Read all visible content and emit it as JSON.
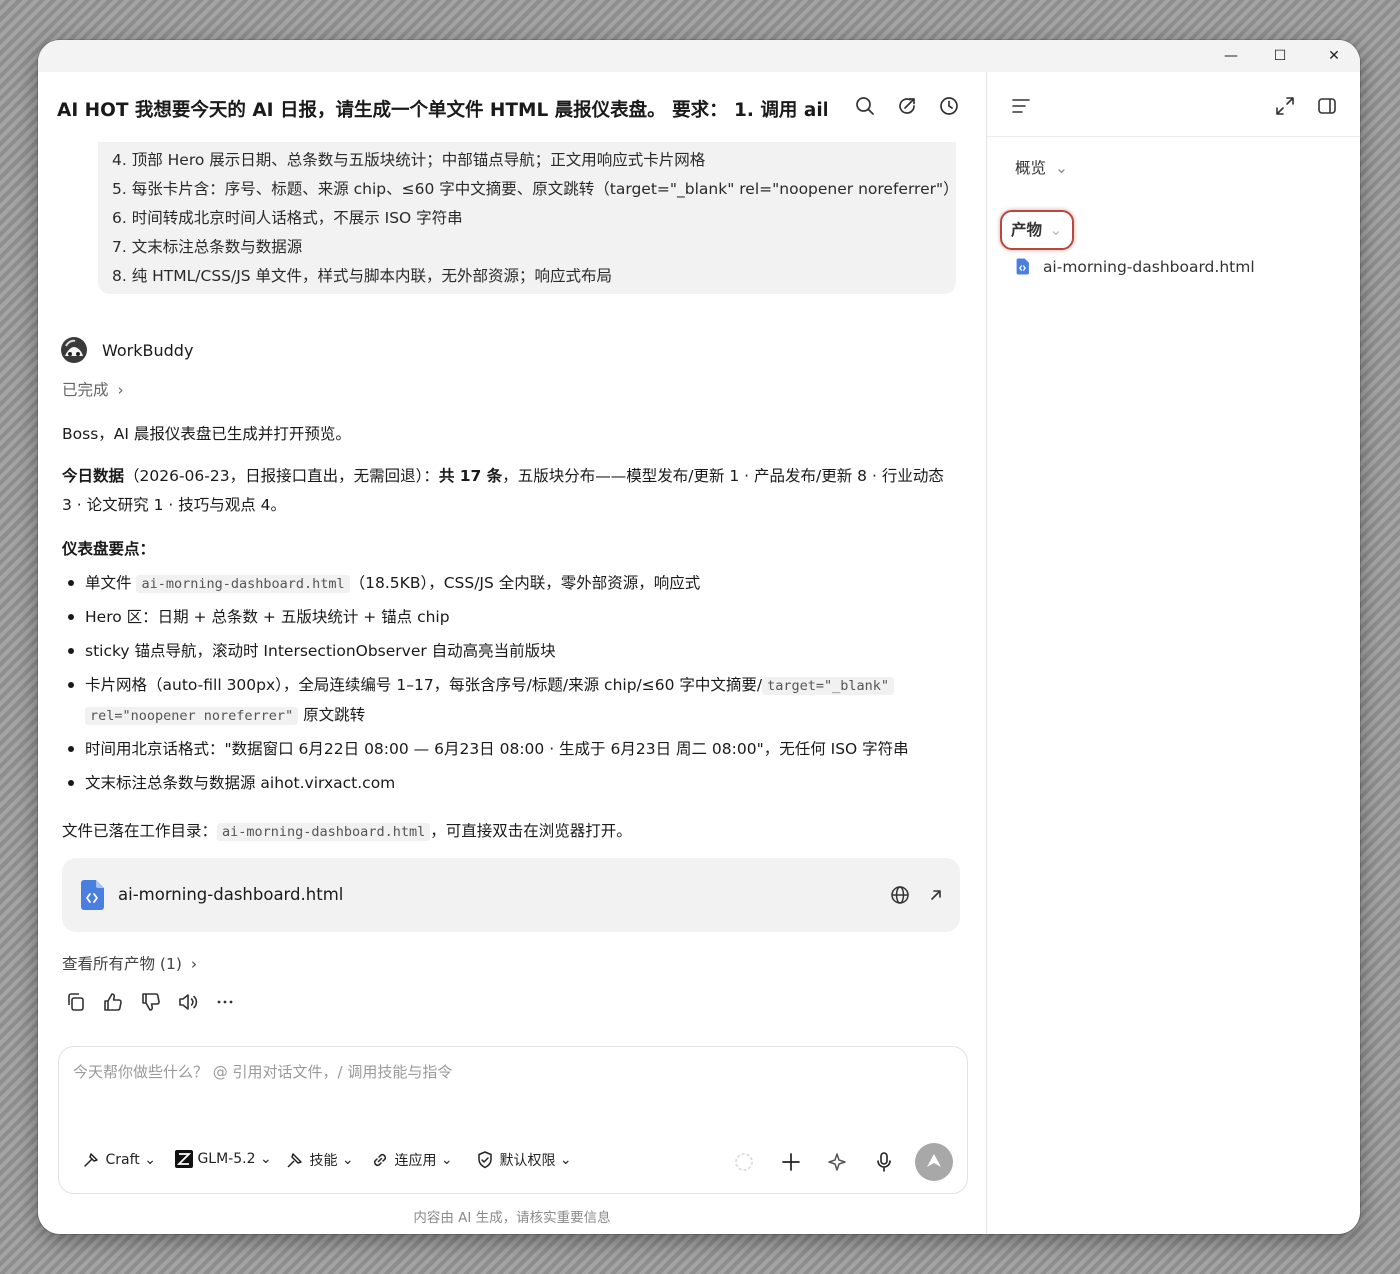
{
  "window": {
    "minimize": "—",
    "maximize": "☐",
    "close": "✕"
  },
  "chat": {
    "title": "AI HOT 我想要今天的 AI 日报，请生成一个单文件 HTML 晨报仪表盘。 要求： 1. 调用 aih...",
    "quote_lines": [
      "4. 顶部 Hero 展示日期、总条数与五版块统计；中部锚点导航；正文用响应式卡片网格",
      "5. 每张卡片含：序号、标题、来源 chip、≤60 字中文摘要、原文跳转（target=\"_blank\" rel=\"noopener noreferrer\"）",
      "6. 时间转成北京时间人话格式，不展示 ISO 字符串",
      "7. 文末标注总条数与数据源",
      "8. 纯 HTML/CSS/JS 单文件，样式与脚本内联，无外部资源；响应式布局"
    ]
  },
  "agent": {
    "name": "WorkBuddy",
    "status": "已完成"
  },
  "reply": {
    "greeting": "Boss，AI 晨报仪表盘已生成并打开预览。",
    "data_label": "今日数据",
    "data_line1_a": "（2026-06-23，日报接口直出，无需回退）：",
    "data_line1_b": "共 17 条",
    "data_line1_c": "，五版块分布——模型发布/更新 1 · 产品发布/更新 8 · 行业动态",
    "data_line2": "3 · 论文研究 1 · 技巧与观点 4。",
    "points_heading": "仪表盘要点：",
    "b1_a": "单文件 ",
    "b1_code": "ai-morning-dashboard.html",
    "b1_b": "（18.5KB），CSS/JS 全内联，零外部资源，响应式",
    "b2": "Hero 区：日期 + 总条数 + 五版块统计 + 锚点 chip",
    "b3": "sticky 锚点导航，滚动时 IntersectionObserver 自动高亮当前版块",
    "b4_a": "卡片网格（auto-fill 300px），全局连续编号 1–17，每张含序号/标题/来源 chip/≤60 字中文摘要/",
    "b4_code1": "target=\"_blank\"",
    "b4_code2": "rel=\"noopener noreferrer\"",
    "b4_b": " 原文跳转",
    "b5": "时间用北京话格式：\"数据窗口 6月22日 08:00 — 6月23日 08:00 · 生成于 6月23日 周二 08:00\"，无任何 ISO 字符串",
    "b6": "文末标注总条数与数据源 aihot.virxact.com",
    "saved_a": "文件已落在工作目录：",
    "saved_code": "ai-morning-dashboard.html",
    "saved_b": "，可直接双击在浏览器打开。",
    "file_card_name": "ai-morning-dashboard.html",
    "view_all": "查看所有产物 (1)"
  },
  "composer": {
    "placeholder": "今天帮你做些什么？ @ 引用对话文件，/ 调用技能与指令",
    "mode": "Craft",
    "model": "GLM-5.2",
    "skills": "技能",
    "apps": "连应用",
    "permission": "默认权限",
    "footer": "内容由 AI 生成，请核实重要信息"
  },
  "sidebar": {
    "overview": "概览",
    "artifacts": "产物",
    "file": "ai-morning-dashboard.html"
  },
  "colors": {
    "accent_file": "#4a7fe0",
    "highlight": "#b3493f",
    "send_button": "#a8a8a8"
  }
}
